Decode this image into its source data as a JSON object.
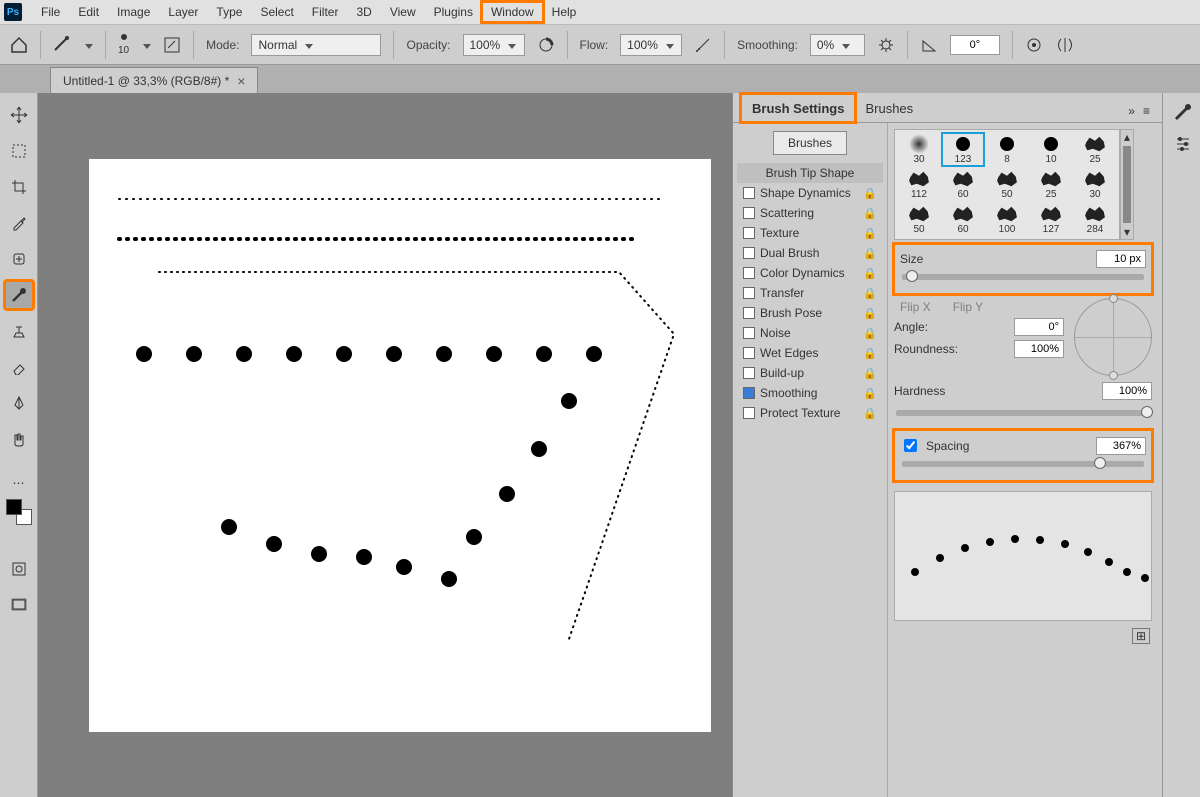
{
  "menu": {
    "items": [
      "File",
      "Edit",
      "Image",
      "Layer",
      "Type",
      "Select",
      "Filter",
      "3D",
      "View",
      "Plugins",
      "Window",
      "Help"
    ]
  },
  "options": {
    "mode_label": "Mode:",
    "mode_value": "Normal",
    "opacity_label": "Opacity:",
    "opacity_value": "100%",
    "flow_label": "Flow:",
    "flow_value": "100%",
    "smoothing_label": "Smoothing:",
    "smoothing_value": "0%",
    "angle_label": "",
    "angle_value": "0°",
    "brush_size_small": "10"
  },
  "document": {
    "tab_title": "Untitled-1 @ 33,3% (RGB/8#) *"
  },
  "panel": {
    "tabs": [
      "Brush Settings",
      "Brushes"
    ],
    "brushes_button": "Brushes",
    "option_list": [
      {
        "label": "Brush Tip Shape",
        "type": "header",
        "active": true
      },
      {
        "label": "Shape Dynamics",
        "checked": false,
        "locked": true
      },
      {
        "label": "Scattering",
        "checked": false,
        "locked": true
      },
      {
        "label": "Texture",
        "checked": false,
        "locked": true
      },
      {
        "label": "Dual Brush",
        "checked": false,
        "locked": true
      },
      {
        "label": "Color Dynamics",
        "checked": false,
        "locked": true
      },
      {
        "label": "Transfer",
        "checked": false,
        "locked": true
      },
      {
        "label": "Brush Pose",
        "checked": false,
        "locked": true
      },
      {
        "label": "Noise",
        "checked": false,
        "locked": true
      },
      {
        "label": "Wet Edges",
        "checked": false,
        "locked": true
      },
      {
        "label": "Build-up",
        "checked": false,
        "locked": true
      },
      {
        "label": "Smoothing",
        "checked": true,
        "locked": true
      },
      {
        "label": "Protect Texture",
        "checked": false,
        "locked": true
      }
    ],
    "tips": [
      {
        "n": "30",
        "kind": "soft"
      },
      {
        "n": "123",
        "kind": "hard",
        "sel": true
      },
      {
        "n": "8",
        "kind": "hard"
      },
      {
        "n": "10",
        "kind": "hard"
      },
      {
        "n": "25",
        "kind": "rough"
      },
      {
        "n": "112",
        "kind": "rough"
      },
      {
        "n": "60",
        "kind": "rough"
      },
      {
        "n": "50",
        "kind": "rough"
      },
      {
        "n": "25",
        "kind": "rough"
      },
      {
        "n": "30",
        "kind": "rough"
      },
      {
        "n": "50",
        "kind": "rough"
      },
      {
        "n": "60",
        "kind": "rough"
      },
      {
        "n": "100",
        "kind": "rough"
      },
      {
        "n": "127",
        "kind": "rough"
      },
      {
        "n": "284",
        "kind": "rough"
      }
    ],
    "size_label": "Size",
    "size_value": "10 px",
    "flipx_label": "Flip X",
    "flipy_label": "Flip Y",
    "angle_label": "Angle:",
    "angle_value": "0°",
    "roundness_label": "Roundness:",
    "roundness_value": "100%",
    "hardness_label": "Hardness",
    "hardness_value": "100%",
    "spacing_label": "Spacing",
    "spacing_value": "367%",
    "spacing_checked": true
  }
}
